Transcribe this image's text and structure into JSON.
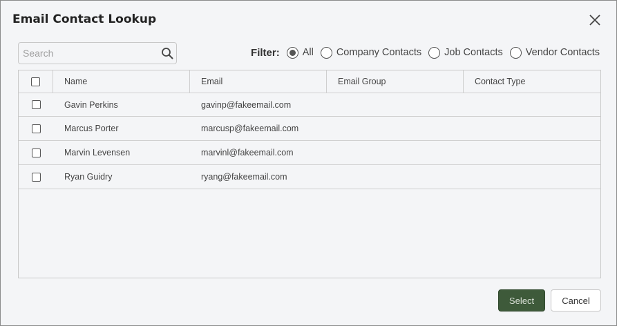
{
  "dialog": {
    "title": "Email Contact Lookup",
    "close_icon": "close-icon"
  },
  "search": {
    "placeholder": "Search",
    "value": "",
    "icon": "search-icon"
  },
  "filter": {
    "label": "Filter:",
    "options": [
      {
        "label": "All",
        "selected": true
      },
      {
        "label": "Company Contacts",
        "selected": false
      },
      {
        "label": "Job Contacts",
        "selected": false
      },
      {
        "label": "Vendor Contacts",
        "selected": false
      }
    ]
  },
  "table": {
    "columns": [
      "Name",
      "Email",
      "Email Group",
      "Contact Type"
    ],
    "rows": [
      {
        "name": "Gavin Perkins",
        "email": "gavinp@fakeemail.com",
        "group": "",
        "type": ""
      },
      {
        "name": "Marcus Porter",
        "email": "marcusp@fakeemail.com",
        "group": "",
        "type": ""
      },
      {
        "name": "Marvin Levensen",
        "email": "marvinl@fakeemail.com",
        "group": "",
        "type": ""
      },
      {
        "name": "Ryan Guidry",
        "email": "ryang@fakeemail.com",
        "group": "",
        "type": ""
      }
    ]
  },
  "buttons": {
    "select": "Select",
    "cancel": "Cancel"
  },
  "colors": {
    "background": "#f4f5f7",
    "primary_button": "#3e5a3a",
    "border": "#c8c8c8"
  }
}
